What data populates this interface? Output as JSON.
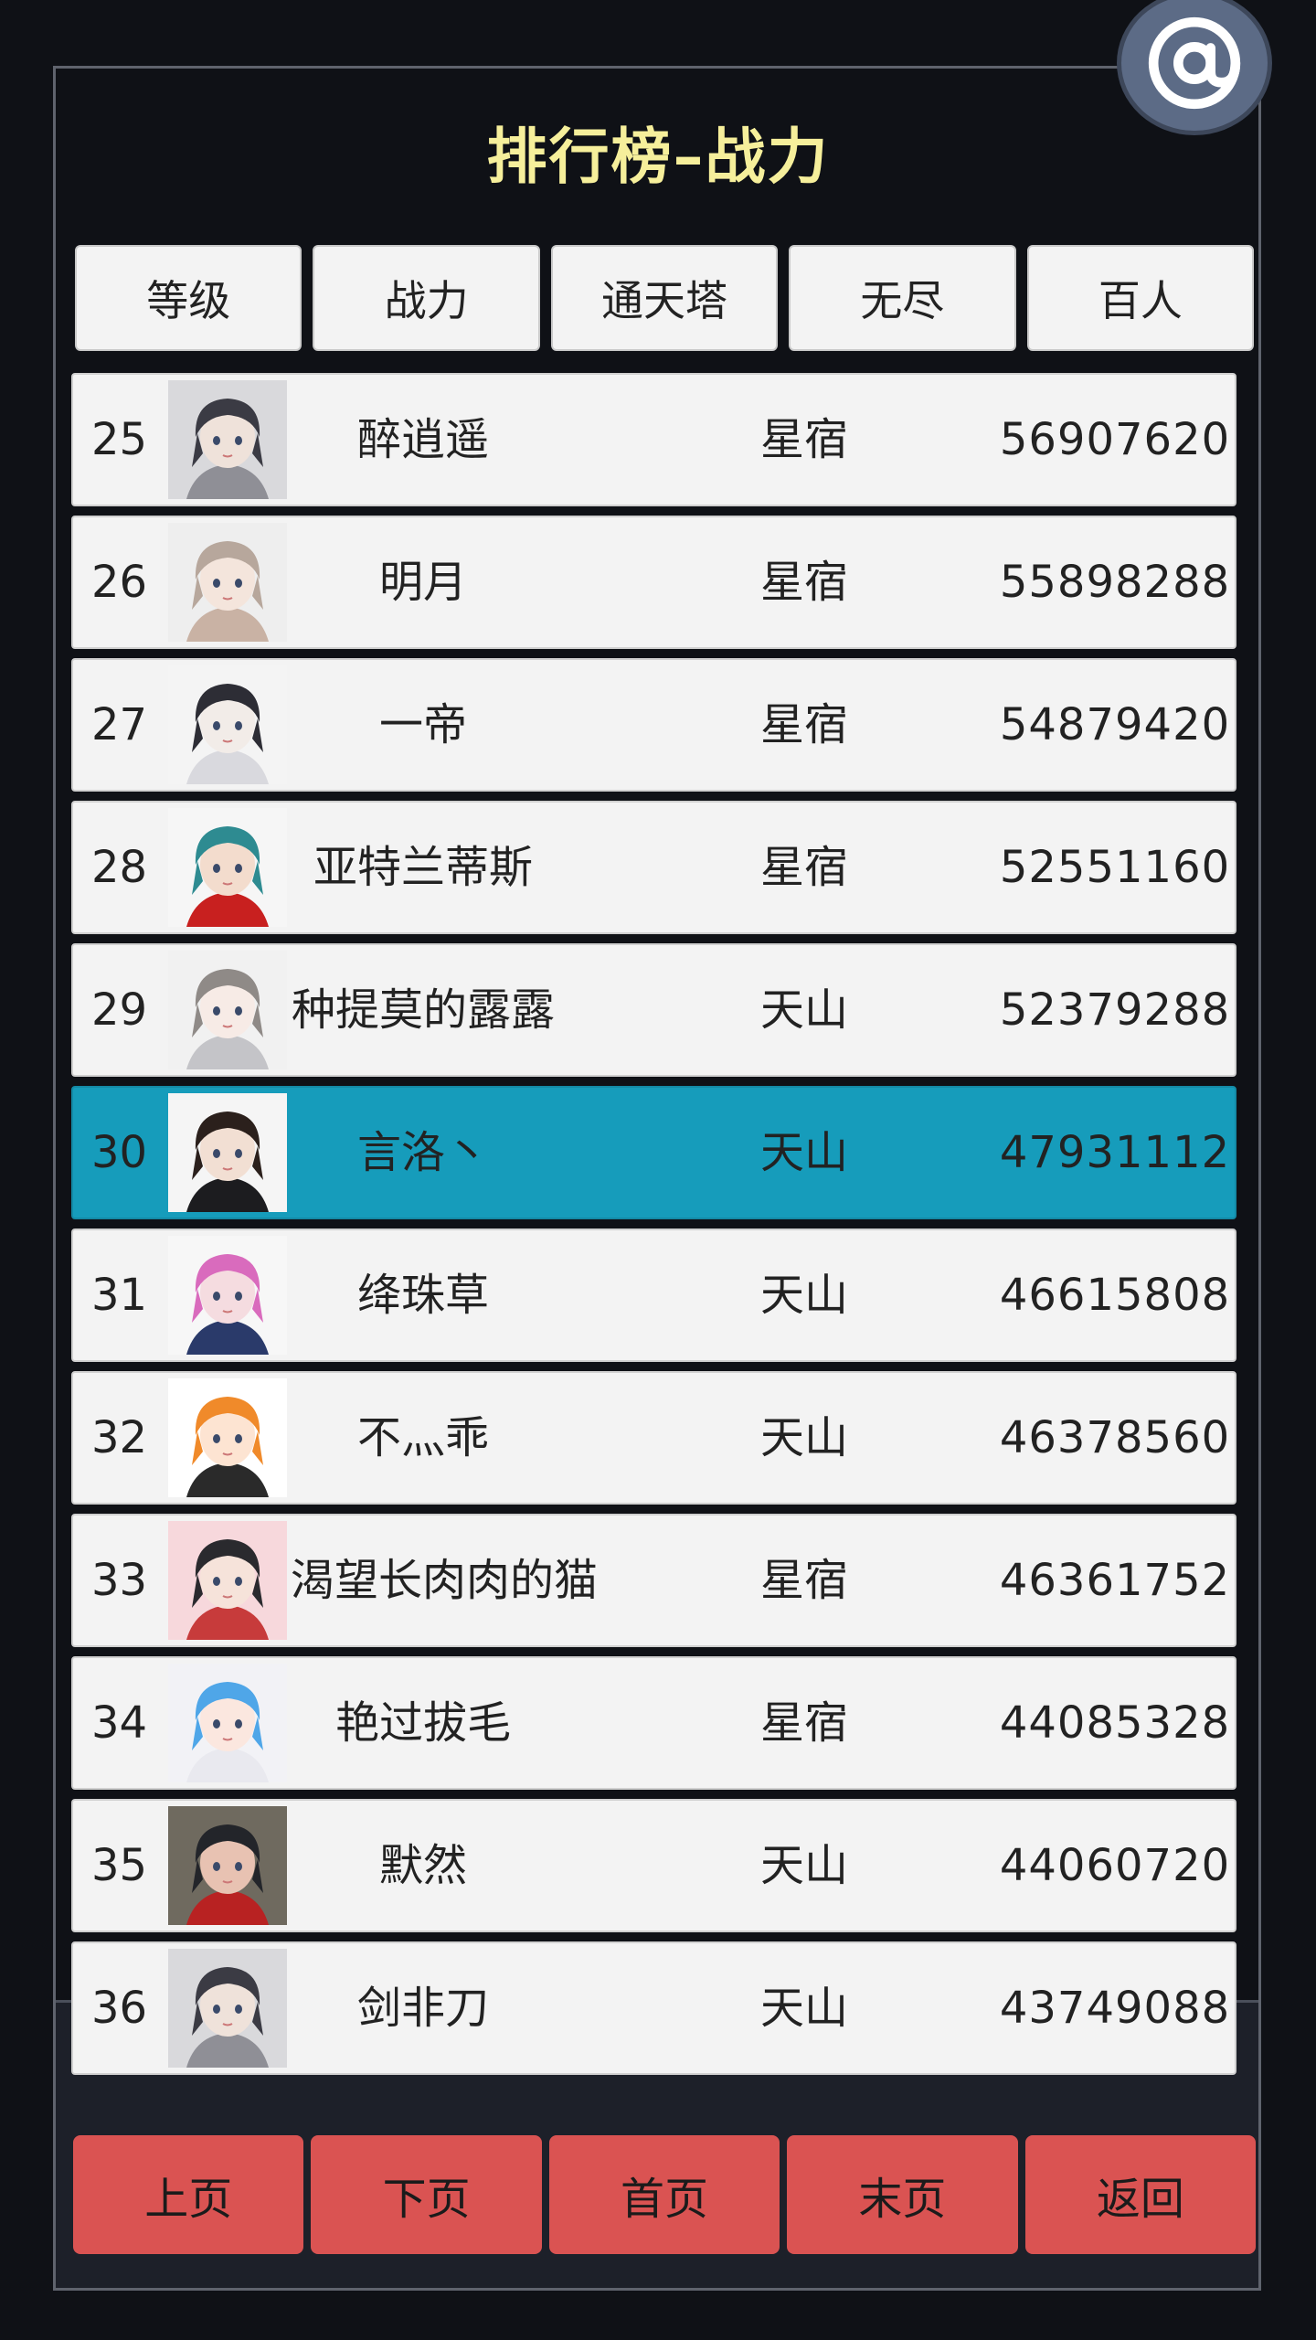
{
  "title": "排行榜–战力",
  "at_button": {
    "label": "@",
    "icon": "at-sign-icon"
  },
  "tabs": [
    {
      "label": "等级"
    },
    {
      "label": "战力"
    },
    {
      "label": "通天塔"
    },
    {
      "label": "无尽"
    },
    {
      "label": "百人"
    }
  ],
  "rows": [
    {
      "rank": "25",
      "name": "醉逍遥",
      "server": "星宿",
      "power": "56907620",
      "highlight": false,
      "avatar": {
        "hair": "#3b3b44",
        "skin": "#efe2da",
        "bg": "#d9d9dc",
        "cloth": "#8f8f96"
      }
    },
    {
      "rank": "26",
      "name": "明月",
      "server": "星宿",
      "power": "55898288",
      "highlight": false,
      "avatar": {
        "hair": "#b7a79c",
        "skin": "#f4e5dc",
        "bg": "#eeeeee",
        "cloth": "#c9b2a4"
      }
    },
    {
      "rank": "27",
      "name": "一帝",
      "server": "星宿",
      "power": "54879420",
      "highlight": false,
      "avatar": {
        "hair": "#2d2d35",
        "skin": "#f2ece8",
        "bg": "#f4f4f4",
        "cloth": "#d9d9de"
      }
    },
    {
      "rank": "28",
      "name": "亚特兰蒂斯",
      "server": "星宿",
      "power": "52551160",
      "highlight": false,
      "avatar": {
        "hair": "#2e8b91",
        "skin": "#f3dccd",
        "bg": "#f6f6f6",
        "cloth": "#c8201f"
      }
    },
    {
      "rank": "29",
      "name": "种提莫的露露",
      "server": "天山",
      "power": "52379288",
      "highlight": false,
      "avatar": {
        "hair": "#8f8a87",
        "skin": "#f7ebe6",
        "bg": "#f1f1f1",
        "cloth": "#c4c4c8"
      }
    },
    {
      "rank": "30",
      "name": "言洛丶",
      "server": "天山",
      "power": "47931112",
      "highlight": true,
      "avatar": {
        "hair": "#2b201c",
        "skin": "#f2dfd3",
        "bg": "#f5f5f5",
        "cloth": "#1c1c1f"
      }
    },
    {
      "rank": "31",
      "name": "绛珠草",
      "server": "天山",
      "power": "46615808",
      "highlight": false,
      "avatar": {
        "hair": "#d96bbd",
        "skin": "#f5dce0",
        "bg": "#f7f7f7",
        "cloth": "#2a3a6a"
      }
    },
    {
      "rank": "32",
      "name": "不灬乖",
      "server": "天山",
      "power": "46378560",
      "highlight": false,
      "avatar": {
        "hair": "#f08a2a",
        "skin": "#fde4d2",
        "bg": "#ffffff",
        "cloth": "#2a2a2a"
      }
    },
    {
      "rank": "33",
      "name": "渴望长肉肉的猫",
      "server": "星宿",
      "power": "46361752",
      "highlight": false,
      "avatar": {
        "hair": "#2a2a2e",
        "skin": "#f6e3da",
        "bg": "#f7d8dc",
        "cloth": "#c73b3b"
      }
    },
    {
      "rank": "34",
      "name": "艳过拔毛",
      "server": "星宿",
      "power": "44085328",
      "highlight": false,
      "avatar": {
        "hair": "#4fa6e8",
        "skin": "#fbe7df",
        "bg": "#f2f2f6",
        "cloth": "#e9e9ef"
      }
    },
    {
      "rank": "35",
      "name": "默然",
      "server": "天山",
      "power": "44060720",
      "highlight": false,
      "avatar": {
        "hair": "#23252a",
        "skin": "#e8c2b2",
        "bg": "#6f6a5f",
        "cloth": "#b82222"
      }
    },
    {
      "rank": "36",
      "name": "剑非刀",
      "server": "天山",
      "power": "43749088",
      "highlight": false,
      "avatar": {
        "hair": "#3b3b44",
        "skin": "#efe2da",
        "bg": "#d9d9dc",
        "cloth": "#8f8f96"
      }
    }
  ],
  "pager": [
    {
      "label": "上页"
    },
    {
      "label": "下页"
    },
    {
      "label": "首页"
    },
    {
      "label": "末页"
    },
    {
      "label": "返回"
    }
  ],
  "colors": {
    "background": "#0f1116",
    "title": "#f6ef9b",
    "highlight_row": "#169cbb",
    "pager_button": "#da5352",
    "tab_button": "#f3f3f3",
    "at_button": "#5c6b86"
  }
}
